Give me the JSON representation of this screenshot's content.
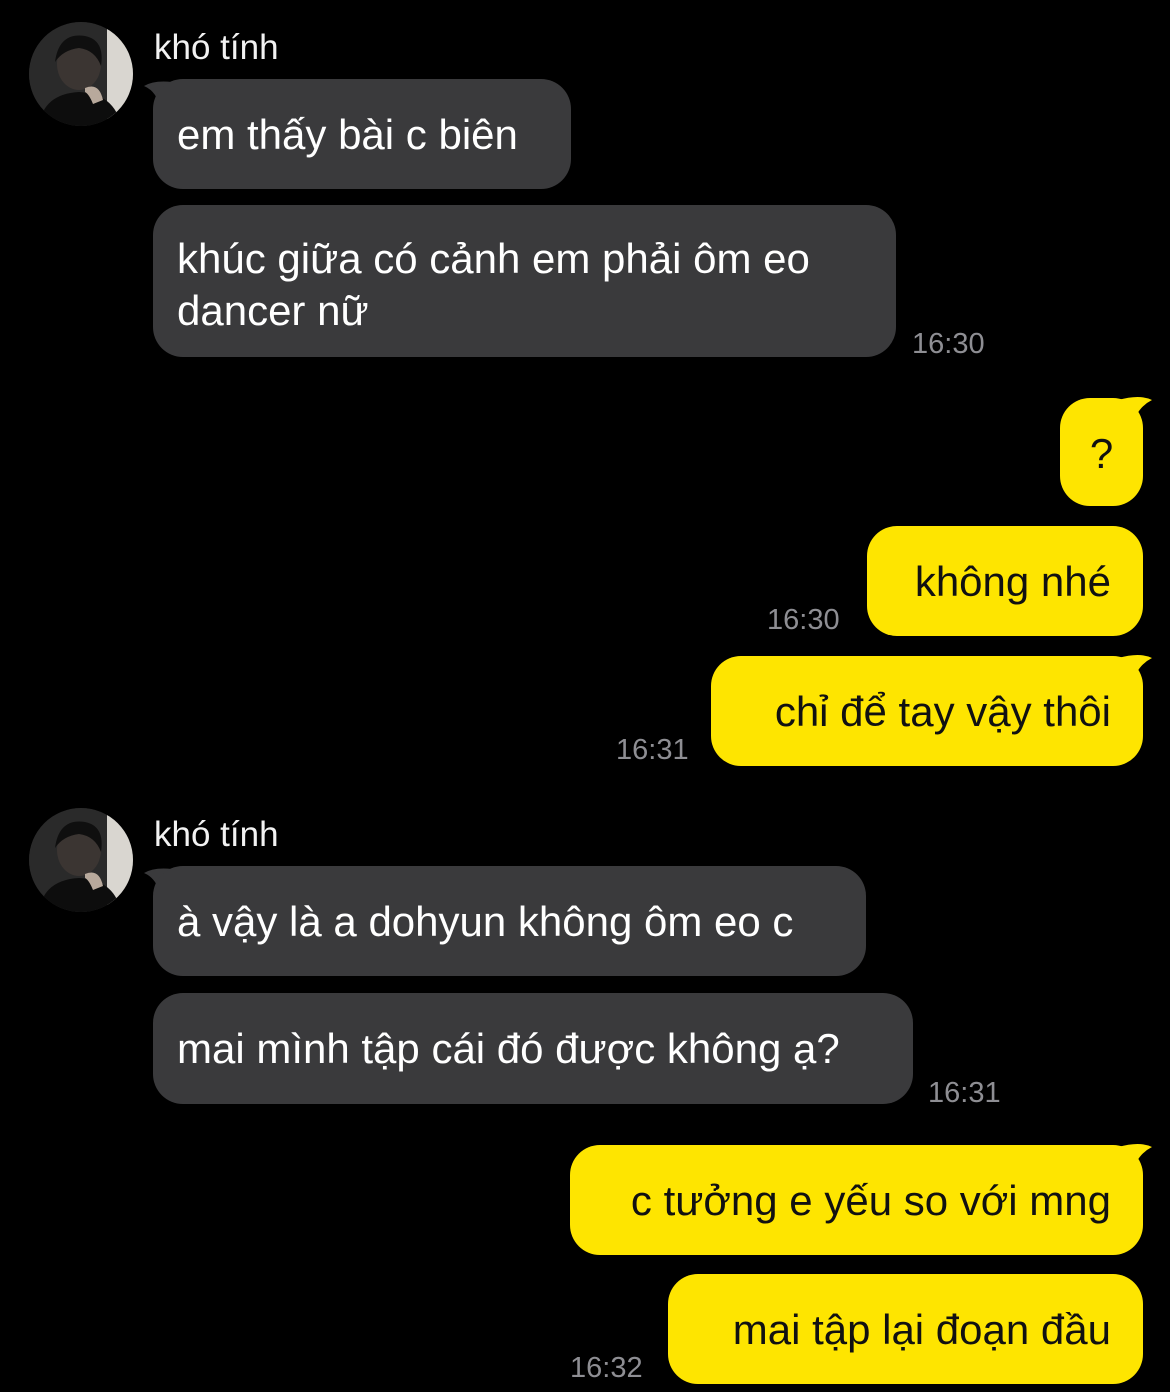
{
  "theme": {
    "background": "#000000",
    "received_bubble": "#3a3a3c",
    "sent_bubble": "#fee500",
    "timestamp_color": "#8e8e93"
  },
  "conversation": {
    "groups": [
      {
        "sender": "khó tính",
        "avatar_icon": "user-avatar-icon",
        "messages": [
          "em thấy bài c biên",
          "khúc giữa có cảnh em phải ôm eo\ndancer nữ"
        ],
        "time": "16:30"
      },
      {
        "sender": "me",
        "messages": [
          "?",
          "không nhé"
        ],
        "time": "16:30"
      },
      {
        "sender": "me",
        "messages": [
          "chỉ để tay vậy thôi"
        ],
        "time": "16:31"
      },
      {
        "sender": "khó tính",
        "avatar_icon": "user-avatar-icon",
        "messages": [
          "à vậy là a dohyun không ôm eo c",
          "mai mình tập cái đó được không ạ?"
        ],
        "time": "16:31"
      },
      {
        "sender": "me",
        "messages": [
          "c tưởng e yếu so với mng",
          "mai tập lại đoạn đầu"
        ],
        "time": "16:32"
      }
    ]
  }
}
